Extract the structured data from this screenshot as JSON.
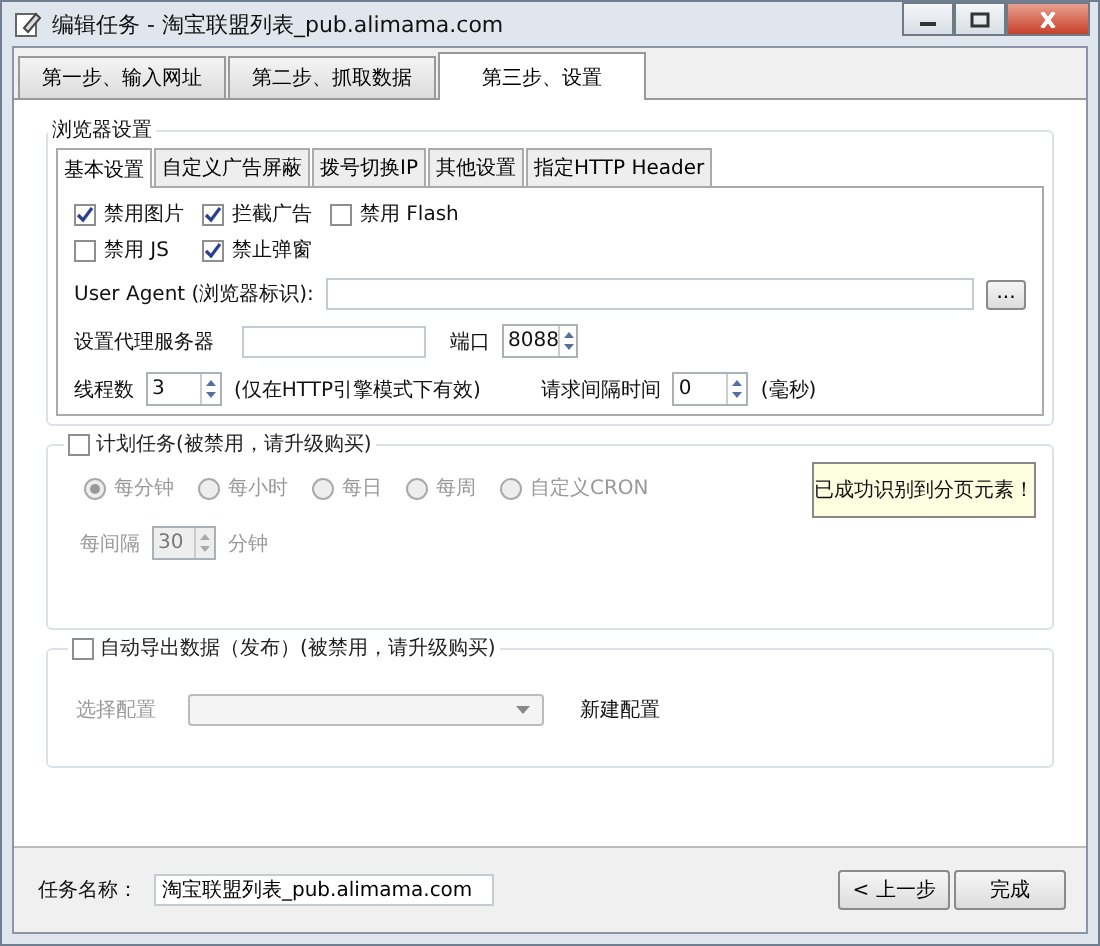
{
  "window": {
    "title": "编辑任务 - 淘宝联盟列表_pub.alimama.com"
  },
  "main_tabs": [
    {
      "label": "第一步、输入网址",
      "selected": false
    },
    {
      "label": "第二步、抓取数据",
      "selected": false
    },
    {
      "label": "第三步、设置",
      "selected": true
    }
  ],
  "browser_settings": {
    "title": "浏览器设置",
    "tabs": [
      {
        "label": "基本设置",
        "selected": true
      },
      {
        "label": "自定义广告屏蔽",
        "selected": false
      },
      {
        "label": "拨号切换IP",
        "selected": false
      },
      {
        "label": "其他设置",
        "selected": false
      },
      {
        "label": "指定HTTP Header",
        "selected": false
      }
    ],
    "checkboxes": [
      {
        "label": "禁用图片",
        "checked": true
      },
      {
        "label": "拦截广告",
        "checked": true
      },
      {
        "label": "禁用 Flash",
        "checked": false
      },
      {
        "label": "禁用 JS",
        "checked": false
      },
      {
        "label": "禁止弹窗",
        "checked": true
      }
    ],
    "user_agent": {
      "label": "User Agent (浏览器标识):",
      "button": "..."
    },
    "proxy": {
      "label": "设置代理服务器"
    },
    "port": {
      "label": "端口",
      "value": "8088"
    },
    "threads": {
      "label": "线程数",
      "value": "3",
      "note": "(仅在HTTP引擎模式下有效)"
    },
    "interval": {
      "label": "请求间隔时间",
      "value": "0",
      "unit": "(毫秒)"
    }
  },
  "schedule": {
    "label": "计划任务(被禁用，请升级购买)",
    "checked": false,
    "disabled": true,
    "options": [
      {
        "label": "每分钟",
        "selected": true
      },
      {
        "label": "每小时",
        "selected": false
      },
      {
        "label": "每日",
        "selected": false
      },
      {
        "label": "每周",
        "selected": false
      },
      {
        "label": "自定义CRON",
        "selected": false
      }
    ],
    "every": {
      "label": "每间隔",
      "value": "30",
      "unit": "分钟"
    }
  },
  "toast": "已成功识别到分页元素！",
  "export": {
    "label": "自动导出数据（发布）(被禁用，请升级购买)",
    "checked": false,
    "disabled": true,
    "select_label": "选择配置",
    "new_config": "新建配置"
  },
  "footer": {
    "label": "任务名称：",
    "value": "淘宝联盟列表_pub.alimama.com",
    "buttons": [
      "< 上一步",
      "完成"
    ]
  }
}
